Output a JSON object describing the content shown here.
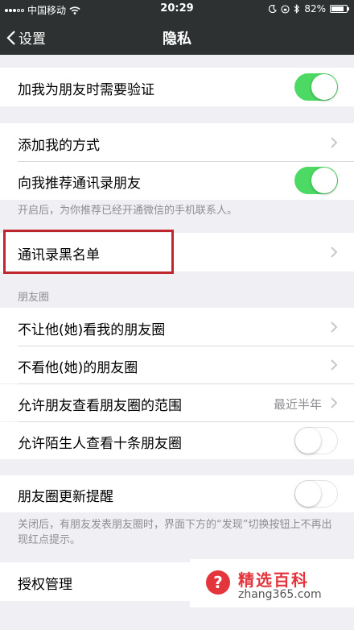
{
  "status_bar": {
    "carrier": "中国移动",
    "time": "20:29",
    "battery": "82%",
    "battery_level": 0.82
  },
  "nav": {
    "back_label": "设置",
    "title": "隐私"
  },
  "rows": {
    "verify_friend": {
      "label": "加我为朋友时需要验证",
      "toggle": "on"
    },
    "add_me_methods": {
      "label": "添加我的方式"
    },
    "recommend_contacts": {
      "label": "向我推荐通讯录朋友",
      "toggle": "on"
    },
    "recommend_note": "开启后，为你推荐已经开通微信的手机联系人。",
    "blacklist": {
      "label": "通讯录黑名单"
    },
    "moments_header": "朋友圈",
    "hide_my_moments": {
      "label": "不让他(她)看我的朋友圈"
    },
    "hide_their_moments": {
      "label": "不看他(她)的朋友圈"
    },
    "moments_range": {
      "label": "允许朋友查看朋友圈的范围",
      "value": "最近半年"
    },
    "stranger_ten": {
      "label": "允许陌生人查看十条朋友圈",
      "toggle": "off"
    },
    "moments_update_alert": {
      "label": "朋友圈更新提醒",
      "toggle": "off"
    },
    "update_note": "关闭后，有朋友发表朋友圈时，界面下方的“发现”切换按钮上不再出现红点提示。",
    "authorization": {
      "label": "授权管理"
    }
  },
  "watermark": {
    "badge": "?",
    "title": "精选百科",
    "url": "zhang365.com"
  },
  "colors": {
    "nav_bg": "#2e3132",
    "toggle_on": "#4cd964",
    "highlight": "#c0262d"
  }
}
